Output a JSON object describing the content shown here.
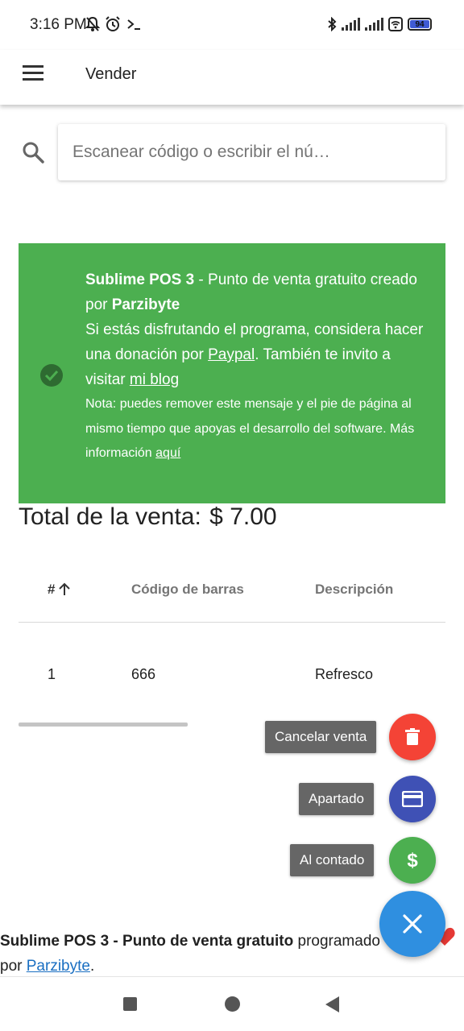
{
  "status_bar": {
    "time": "3:16 PM",
    "battery": "94",
    "left_icons": [
      "mute-bell-icon",
      "alarm-icon",
      "terminal-icon"
    ],
    "right_icons": [
      "bluetooth-icon",
      "signal-icon",
      "signal-icon",
      "wifi-icon",
      "battery-icon"
    ]
  },
  "app_bar": {
    "title": "Vender",
    "menu_icon": "menu-icon"
  },
  "search": {
    "placeholder": "Escanear código o escribir el nú…"
  },
  "notice": {
    "brand": "Sublime POS 3",
    "line1_rest": " - Punto de venta gratuito creado por ",
    "author": "Parzibyte",
    "line2": "Si estás disfrutando el programa, considera hacer una donación por ",
    "paypal_link": "Paypal",
    "line3": ". También te invito a visitar ",
    "blog_link": "mi blog",
    "note": "Nota: puedes remover este mensaje y el pie de página al mismo tiempo que apoyas el desarrollo del software. Más información ",
    "note_link": "aquí",
    "color": "#4caf50"
  },
  "total": {
    "label": "Total de la venta:",
    "value": "$ 7.00"
  },
  "table": {
    "headers": {
      "num": "#",
      "code": "Código de barras",
      "desc": "Descripción"
    },
    "rows": [
      {
        "num": "1",
        "code": "666",
        "desc": "Refresco"
      }
    ]
  },
  "fab": {
    "actions": [
      {
        "label": "Cancelar venta",
        "icon": "trash-icon",
        "color": "#f44336"
      },
      {
        "label": "Apartado",
        "icon": "credit-card-icon",
        "color": "#3f51b5"
      },
      {
        "label": "Al contado",
        "icon": "dollar-icon",
        "color": "#4caf50"
      }
    ],
    "main_icon": "close-icon",
    "main_color": "#2f8fe0"
  },
  "footer": {
    "bold": "Sublime POS 3 - Punto de venta gratuito",
    "text": " programado por ",
    "link": "Parzibyte",
    "end": "."
  }
}
